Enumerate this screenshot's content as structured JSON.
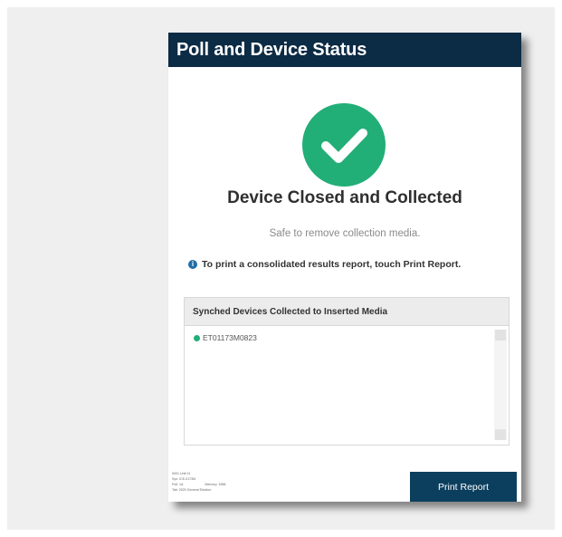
{
  "window": {
    "title": "Poll and Device Status"
  },
  "status": {
    "icon": "checkmark-circle-icon",
    "heading": "Device Closed and Collected",
    "subtext": "Safe to remove collection media.",
    "notice_icon": "info-icon",
    "notice": "To print a consolidated results report, touch Print Report."
  },
  "panel": {
    "header": "Synched Devices Collected to Inserted Media",
    "devices": [
      "ET01173M0823"
    ]
  },
  "footer": {
    "lines": [
      "0001 Unit 01",
      "Sys: ICE-0173M",
      "Poll: 1A",
      "Memory: 1988",
      "Tab: 2020 General Election"
    ]
  },
  "actions": {
    "print_report": "Print Report"
  },
  "colors": {
    "titlebar": "#0c2b44",
    "success": "#22ae77",
    "button": "#0c3f5e",
    "info": "#1f6fa8"
  }
}
